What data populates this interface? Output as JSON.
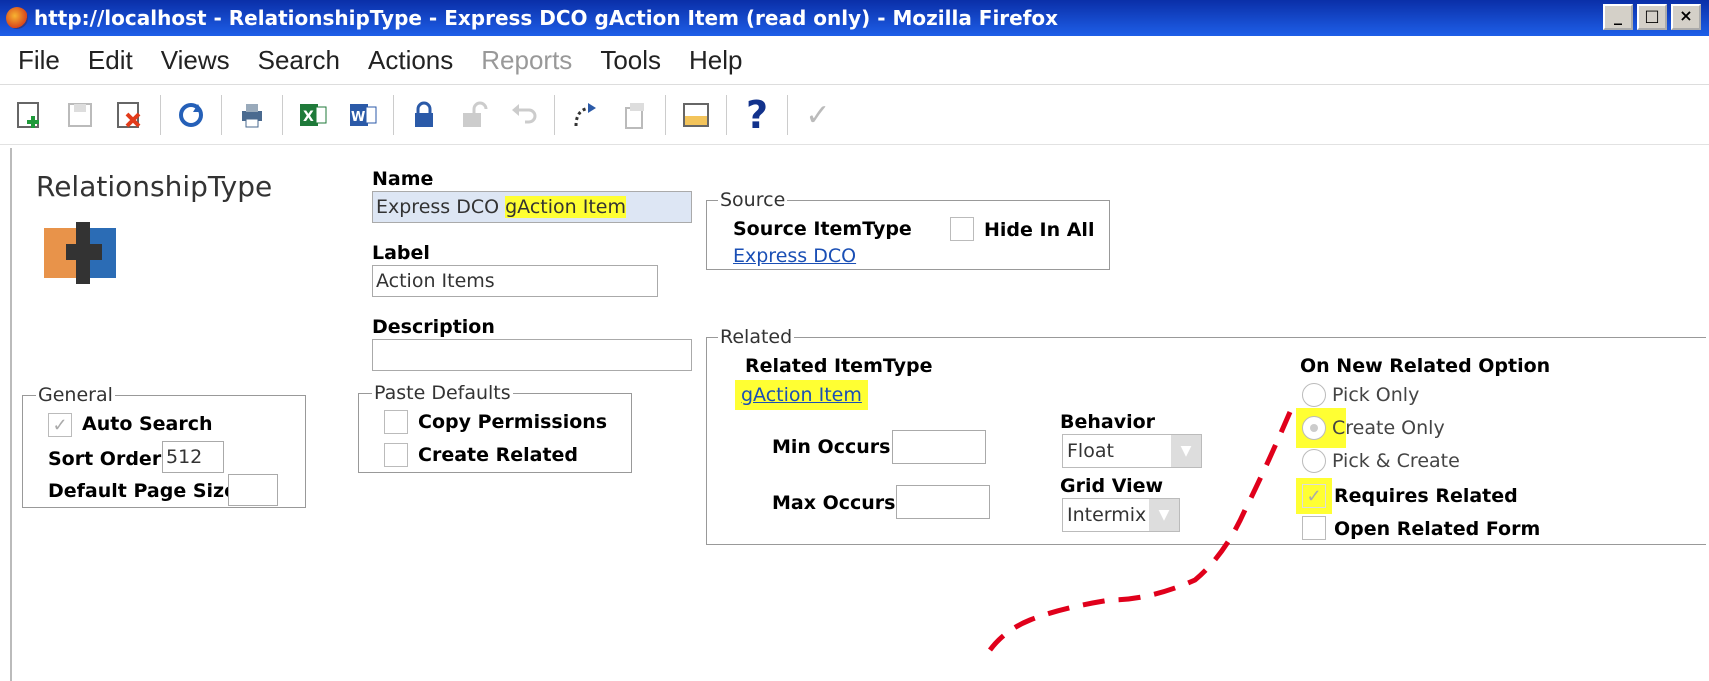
{
  "window": {
    "title": "http://localhost - RelationshipType - Express DCO gAction Item (read only) - Mozilla Firefox",
    "minimize_label": "_",
    "maximize_label": "□",
    "close_label": "×"
  },
  "menu": {
    "file": "File",
    "edit": "Edit",
    "views": "Views",
    "search": "Search",
    "actions": "Actions",
    "reports": "Reports",
    "tools": "Tools",
    "help": "Help"
  },
  "toolbar": {
    "icons": [
      "new-icon",
      "save-icon",
      "delete-icon",
      "refresh-icon",
      "print-icon",
      "excel-icon",
      "word-icon",
      "lock-icon",
      "unlock-icon",
      "undo-icon",
      "promote-icon",
      "copy-icon",
      "layout-icon",
      "help-icon",
      "done-icon"
    ]
  },
  "form": {
    "item_type": "RelationshipType",
    "name_label": "Name",
    "name_value_prefix": "Express DCO ",
    "name_value_highlight": "gAction Item",
    "label_label": "Label",
    "label_value": "Action Items",
    "description_label": "Description",
    "description_value": "",
    "general": {
      "legend": "General",
      "auto_search": "Auto Search",
      "sort_order_label": "Sort Order",
      "sort_order_value": "512",
      "default_page_size": "Default Page Size",
      "default_page_size_value": ""
    },
    "paste_defaults": {
      "legend": "Paste Defaults",
      "copy_permissions": "Copy Permissions",
      "create_related": "Create Related"
    },
    "source": {
      "legend": "Source",
      "itemtype_label": "Source ItemType",
      "itemtype_value": "Express DCO",
      "hide_in_all": "Hide In All"
    },
    "related": {
      "legend": "Related",
      "itemtype_label": "Related ItemType",
      "itemtype_value": "gAction Item",
      "min_occurs": "Min Occurs",
      "max_occurs": "Max Occurs",
      "behavior_label": "Behavior",
      "behavior_value": "Float",
      "grid_view_label": "Grid View",
      "grid_view_value": "Intermix",
      "on_new_label": "On New Related Option",
      "pick_only": "Pick Only",
      "create_only": "Create Only",
      "pick_create": "Pick & Create",
      "requires_related": "Requires Related",
      "open_related_form": "Open Related Form"
    }
  },
  "colors": {
    "highlight": "#ffff33",
    "title_bar": "#1e5fe8",
    "annotation": "#e0001b",
    "link": "#1a4fb5"
  }
}
